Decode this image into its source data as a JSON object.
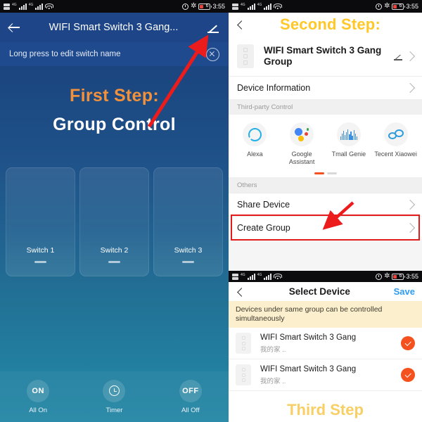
{
  "status_bar": {
    "time": "3:55",
    "battery_level": "6"
  },
  "left": {
    "appbar": {
      "title": "WIFI Smart Switch 3 Gang...",
      "back_icon": "back-arrow-icon",
      "edit_icon": "pencil-icon"
    },
    "hint": {
      "text": "Long press to edit switch name",
      "close_icon": "close-circle-icon"
    },
    "annotation": {
      "line1": "First Step:",
      "line2": "Group Control",
      "line1_color": "#f2913c",
      "line2_color": "#ffffff"
    },
    "switches": [
      {
        "label": "Switch 1"
      },
      {
        "label": "Switch 2"
      },
      {
        "label": "Switch 3"
      }
    ],
    "bottom_bar": [
      {
        "icon_text": "ON",
        "label": "All On",
        "icon_name": "power-on-icon"
      },
      {
        "icon_text": "",
        "label": "Timer",
        "icon_name": "clock-icon"
      },
      {
        "icon_text": "OFF",
        "label": "All Off",
        "icon_name": "power-off-icon"
      }
    ]
  },
  "right": {
    "annotation_step2": "Second Step:",
    "annotation_step2_color": "#ffc727",
    "device": {
      "name": "WIFI Smart Switch 3 Gang Group",
      "edit_icon": "pencil-icon",
      "chevron_icon": "chevron-right-icon"
    },
    "device_information_row": "Device Information",
    "section_third_party": "Third-party Control",
    "third_party": [
      {
        "label": "Alexa",
        "icon": "alexa-icon"
      },
      {
        "label": "Google Assistant",
        "icon": "google-assistant-icon"
      },
      {
        "label": "Tmall Genie",
        "icon": "tmall-genie-icon"
      },
      {
        "label": "Tecent Xiaowei",
        "icon": "tencent-xiaowei-icon"
      }
    ],
    "section_others": "Others",
    "share_device_row": "Share Device",
    "create_group_row": "Create Group",
    "highlight_color": "#e21b1b",
    "accent_color": "#f4511e"
  },
  "third": {
    "appbar": {
      "title": "Select Device",
      "save_label": "Save",
      "back_icon": "chevron-left-icon"
    },
    "banner": "Devices under same group can be controlled simultaneously",
    "devices": [
      {
        "name": "WIFI Smart Switch 3 Gang",
        "room": "我的家 ..",
        "selected": true
      },
      {
        "name": "WIFI Smart Switch 3 Gang",
        "room": "我的家 ..",
        "selected": true
      }
    ],
    "annotation_step3": "Third Step",
    "annotation_step3_color": "#f8cf64"
  }
}
